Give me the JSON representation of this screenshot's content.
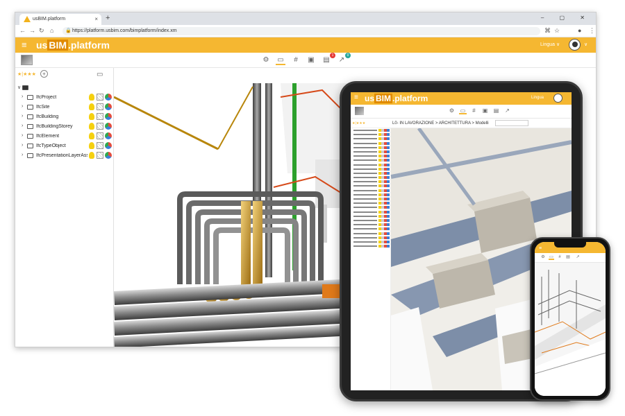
{
  "browser": {
    "tab_title": "usBIM.platform",
    "tab_close": "×",
    "new_tab": "+",
    "window_controls": "– ▢ ✕",
    "url": "https://platform.usbim.com/bimplatform/index.xm"
  },
  "app": {
    "logo_prefix": "us",
    "logo_bim": "BIM",
    "logo_suffix": ".platform",
    "language_label": "Lingua",
    "language_chevron": "∨"
  },
  "toolbar": {
    "badge_red": "1",
    "badge_green": "0"
  },
  "tree": {
    "stars": "★|★★★",
    "add_symbol": "+",
    "items": [
      {
        "label": "IfcProject"
      },
      {
        "label": "IfcSite"
      },
      {
        "label": "IfcBuilding"
      },
      {
        "label": "IfcBuildingStorey"
      },
      {
        "label": "IfcElement"
      },
      {
        "label": "IfcTypeObject"
      },
      {
        "label": "IfcPresentationLayerAssig..."
      }
    ]
  },
  "tablet": {
    "breadcrumb": "L0- IN LAVORAZIONE > ARCHITETTURA > Modelli",
    "language_label": "Lingua"
  },
  "colors": {
    "brand": "#f5b731",
    "brand_dark": "#e08a00",
    "badge_red": "#e53935",
    "badge_green": "#26a69a"
  },
  "icons": {
    "menu": "hamburger-icon",
    "settings": "gear-icon",
    "files": "folder-icon",
    "hash": "hash-icon",
    "briefcase": "briefcase-icon",
    "clipboard": "clipboard-icon",
    "chart": "chart-icon"
  }
}
